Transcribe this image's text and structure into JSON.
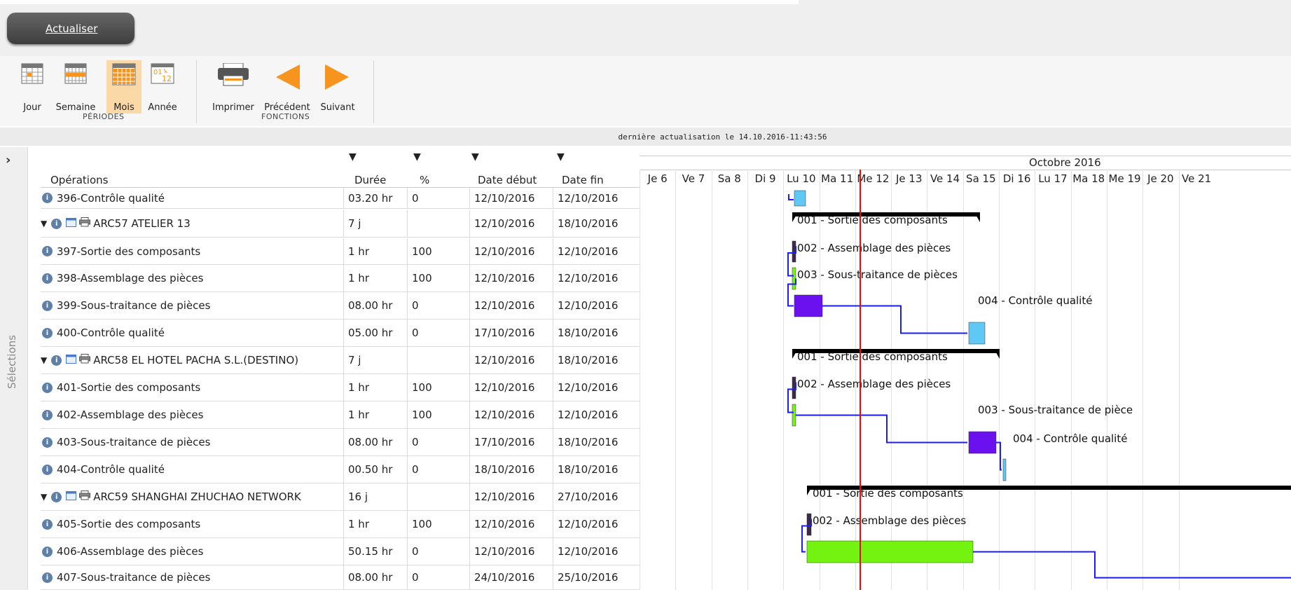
{
  "toolbar": {
    "refresh_label": "Actualiser"
  },
  "periods": {
    "group_label": "PÉRIODES",
    "items": [
      {
        "label": "Jour",
        "icon": "calendar-day-icon"
      },
      {
        "label": "Semaine",
        "icon": "calendar-week-icon"
      },
      {
        "label": "Mois",
        "icon": "calendar-month-icon",
        "selected": true
      },
      {
        "label": "Année",
        "icon": "calendar-year-icon",
        "glyph": "01 12"
      }
    ]
  },
  "functions": {
    "group_label": "FONCTIONS",
    "items": [
      {
        "label": "Imprimer",
        "icon": "printer-icon"
      },
      {
        "label": "Précédent",
        "icon": "arrow-left-icon"
      },
      {
        "label": "Suivant",
        "icon": "arrow-right-icon"
      }
    ]
  },
  "last_update": "dernière actualisation le 14.10.2016-11:43:56",
  "sidebar": {
    "toggle_icon": "chevron-right-icon",
    "label": "Sélections"
  },
  "table": {
    "columns": [
      "Opérations",
      "Durée",
      "%",
      "Date début",
      "Date fin"
    ],
    "rows": [
      {
        "type": "op",
        "name": "396-Contrôle qualité",
        "duration": "03.20 hr",
        "pct": "0",
        "start": "12/10/2016",
        "end": "12/10/2016"
      },
      {
        "type": "group",
        "name": "ARC57 ATELIER 13",
        "duration": "7 j",
        "pct": "",
        "start": "12/10/2016",
        "end": "18/10/2016"
      },
      {
        "type": "op",
        "name": "397-Sortie des composants",
        "duration": "1 hr",
        "pct": "100",
        "start": "12/10/2016",
        "end": "12/10/2016"
      },
      {
        "type": "op",
        "name": "398-Assemblage des pièces",
        "duration": "1 hr",
        "pct": "100",
        "start": "12/10/2016",
        "end": "12/10/2016"
      },
      {
        "type": "op",
        "name": "399-Sous-traitance de pièces",
        "duration": "08.00 hr",
        "pct": "0",
        "start": "12/10/2016",
        "end": "12/10/2016"
      },
      {
        "type": "op",
        "name": "400-Contrôle qualité",
        "duration": "05.00 hr",
        "pct": "0",
        "start": "17/10/2016",
        "end": "18/10/2016"
      },
      {
        "type": "group",
        "name": "ARC58 EL HOTEL PACHA S.L.(DESTINO)",
        "duration": "7 j",
        "pct": "",
        "start": "12/10/2016",
        "end": "18/10/2016"
      },
      {
        "type": "op",
        "name": "401-Sortie des composants",
        "duration": "1 hr",
        "pct": "100",
        "start": "12/10/2016",
        "end": "12/10/2016"
      },
      {
        "type": "op",
        "name": "402-Assemblage des pièces",
        "duration": "1 hr",
        "pct": "100",
        "start": "12/10/2016",
        "end": "12/10/2016"
      },
      {
        "type": "op",
        "name": "403-Sous-traitance de pièces",
        "duration": "08.00 hr",
        "pct": "0",
        "start": "17/10/2016",
        "end": "18/10/2016"
      },
      {
        "type": "op",
        "name": "404-Contrôle qualité",
        "duration": "00.50 hr",
        "pct": "0",
        "start": "18/10/2016",
        "end": "18/10/2016"
      },
      {
        "type": "group",
        "name": "ARC59 SHANGHAI ZHUCHAO NETWORK",
        "duration": "16 j",
        "pct": "",
        "start": "12/10/2016",
        "end": "27/10/2016"
      },
      {
        "type": "op",
        "name": "405-Sortie des composants",
        "duration": "1 hr",
        "pct": "100",
        "start": "12/10/2016",
        "end": "12/10/2016"
      },
      {
        "type": "op",
        "name": "406-Assemblage des pièces",
        "duration": "50.15 hr",
        "pct": "0",
        "start": "12/10/2016",
        "end": "12/10/2016"
      },
      {
        "type": "op",
        "name": "407-Sous-traitance de pièces",
        "duration": "08.00 hr",
        "pct": "0",
        "start": "24/10/2016",
        "end": "25/10/2016"
      }
    ]
  },
  "gantt": {
    "month_label": "Octobre 2016",
    "days": [
      "Je 6",
      "Ve 7",
      "Sa 8",
      "Di 9",
      "Lu 10",
      "Ma 11",
      "Me 12",
      "Je 13",
      "Ve 14",
      "Sa 15",
      "Di 16",
      "Lu 17",
      "Ma 18",
      "Me 19",
      "Je 20",
      "Ve 21"
    ],
    "bar_labels": [
      {
        "row": 1,
        "text": "001 - Sortie des composants"
      },
      {
        "row": 2,
        "text": "002 - Assemblage des pièces"
      },
      {
        "row": 3,
        "text": "003 - Sous-traitance de pièces"
      },
      {
        "row": 4,
        "text": "004 - Contrôle qualité"
      },
      {
        "row": 6,
        "text": "001 - Sortie des composants"
      },
      {
        "row": 7,
        "text": "002 - Assemblage des pièces"
      },
      {
        "row": 8,
        "text": "003 - Sous-traitance de pièce"
      },
      {
        "row": 9,
        "text": "004 - Contrôle qualité"
      },
      {
        "row": 11,
        "text": "001 - Sortie des composants"
      },
      {
        "row": 12,
        "text": "002 - Assemblage des pièces"
      }
    ],
    "colors": {
      "today": "#ff0000",
      "link": "#1b1bff",
      "qc": "#5fc8f5",
      "subcontract": "#6b10ee",
      "assembly": "#73f30f",
      "group": "#000000"
    }
  }
}
